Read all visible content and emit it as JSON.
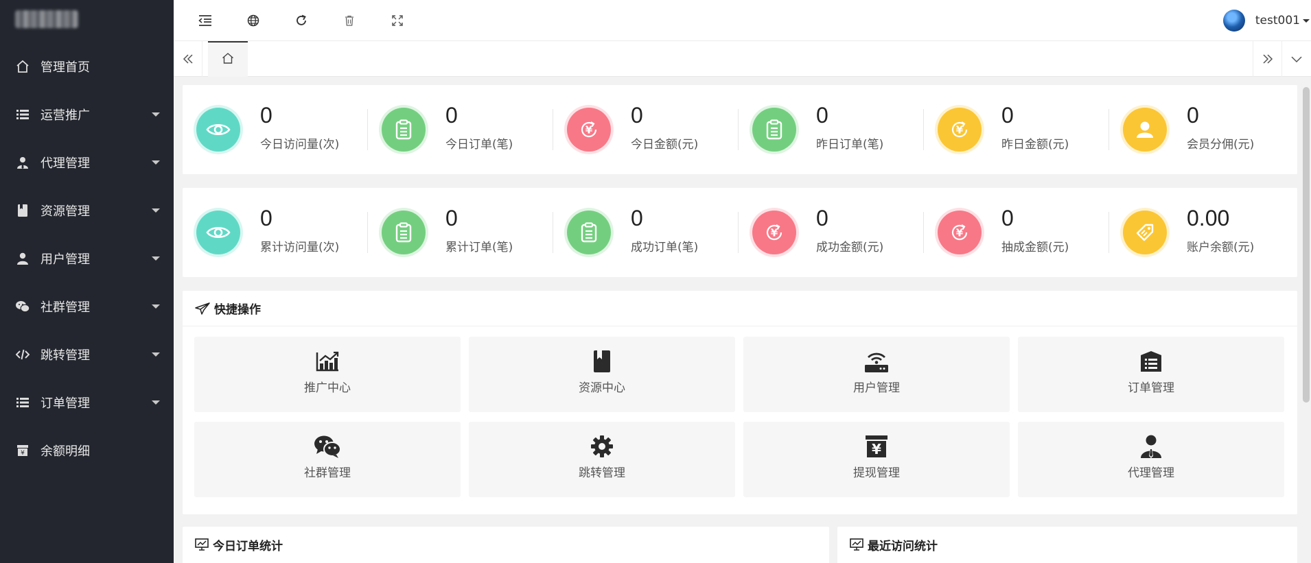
{
  "sidebar": {
    "items": [
      {
        "label": "管理首页",
        "icon": "home-icon",
        "has_children": false
      },
      {
        "label": "运营推广",
        "icon": "list-icon",
        "has_children": true
      },
      {
        "label": "代理管理",
        "icon": "agent-icon",
        "has_children": true
      },
      {
        "label": "资源管理",
        "icon": "bookmark-icon",
        "has_children": true
      },
      {
        "label": "用户管理",
        "icon": "user-icon",
        "has_children": true
      },
      {
        "label": "社群管理",
        "icon": "wechat-icon",
        "has_children": true
      },
      {
        "label": "跳转管理",
        "icon": "code-icon",
        "has_children": true
      },
      {
        "label": "订单管理",
        "icon": "list-icon",
        "has_children": true
      },
      {
        "label": "余额明细",
        "icon": "archive-icon",
        "has_children": false
      }
    ]
  },
  "header": {
    "tools": [
      "collapse-menu-icon",
      "globe-icon",
      "refresh-icon",
      "clear-cache-icon",
      "fullscreen-icon"
    ],
    "username": "test001"
  },
  "stats_today": [
    {
      "value": "0",
      "label": "今日访问量(次)",
      "icon": "eye-icon",
      "color": "#5fd9c6"
    },
    {
      "value": "0",
      "label": "今日订单(笔)",
      "icon": "clipboard-icon",
      "color": "#73cf7f"
    },
    {
      "value": "0",
      "label": "今日金额(元)",
      "icon": "yen-refresh-icon",
      "color": "#f87887"
    },
    {
      "value": "0",
      "label": "昨日订单(笔)",
      "icon": "clipboard-icon",
      "color": "#73cf7f"
    },
    {
      "value": "0",
      "label": "昨日金额(元)",
      "icon": "yen-refresh-icon",
      "color": "#fbc634"
    },
    {
      "value": "0",
      "label": "会员分佣(元)",
      "icon": "user-icon",
      "color": "#fbc634"
    }
  ],
  "stats_total": [
    {
      "value": "0",
      "label": "累计访问量(次)",
      "icon": "eye-icon",
      "color": "#5fd9c6"
    },
    {
      "value": "0",
      "label": "累计订单(笔)",
      "icon": "clipboard-icon",
      "color": "#73cf7f"
    },
    {
      "value": "0",
      "label": "成功订单(笔)",
      "icon": "clipboard-icon",
      "color": "#73cf7f"
    },
    {
      "value": "0",
      "label": "成功金额(元)",
      "icon": "yen-refresh-icon",
      "color": "#f87887"
    },
    {
      "value": "0",
      "label": "抽成金额(元)",
      "icon": "yen-refresh-icon",
      "color": "#f87887"
    },
    {
      "value": "0.00",
      "label": "账户余额(元)",
      "icon": "tag-icon",
      "color": "#fbc634"
    }
  ],
  "quick_ops": {
    "title": "快捷操作",
    "items": [
      {
        "label": "推广中心",
        "icon": "chart-icon"
      },
      {
        "label": "资源中心",
        "icon": "bookmark-icon"
      },
      {
        "label": "用户管理",
        "icon": "router-icon"
      },
      {
        "label": "订单管理",
        "icon": "list-box-icon"
      },
      {
        "label": "社群管理",
        "icon": "wechat-icon"
      },
      {
        "label": "跳转管理",
        "icon": "gear-icon"
      },
      {
        "label": "提现管理",
        "icon": "yen-box-icon"
      },
      {
        "label": "代理管理",
        "icon": "agent-icon"
      }
    ]
  },
  "bottom_panels": {
    "today_orders": "今日订单统计",
    "recent_visits": "最近访问统计"
  }
}
